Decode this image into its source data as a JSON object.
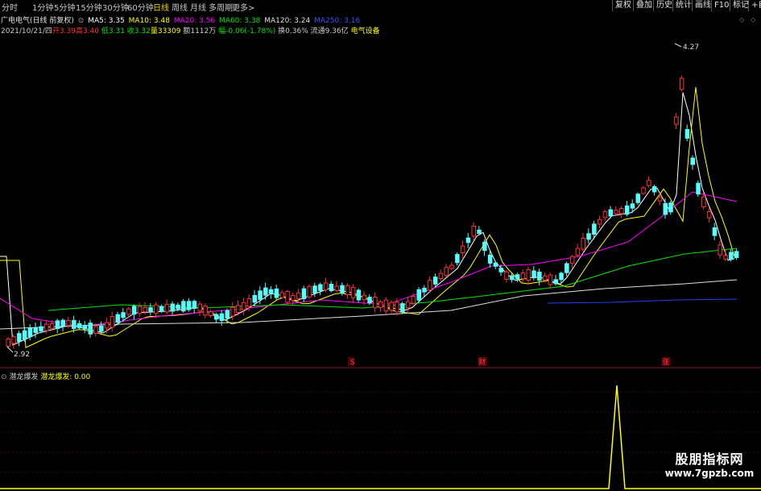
{
  "toolbar": {
    "timeframes": [
      "分时",
      "1分钟",
      "5分钟",
      "15分钟",
      "30分钟",
      "60分钟",
      "日线",
      "周线",
      "月线",
      "多周期",
      "更多>"
    ],
    "active": "日线",
    "right_buttons": [
      "复权",
      "叠加",
      "历史",
      "统计",
      "画线",
      "F10",
      "标记",
      "+自"
    ]
  },
  "info": {
    "stock": "广电电气(日线 前复权)",
    "ma5": "MA5: 3.35",
    "ma10": "MA10: 3.48",
    "ma20": "MA20: 3.56",
    "ma60": "MA60: 3.38",
    "ma120": "MA120: 3.24",
    "ma250": "MA250: 3.16",
    "date": "2021/10/21/四",
    "open": "开3.39",
    "high": "高3.40",
    "low": "低3.31",
    "close": "收3.32",
    "volume": "量33309",
    "amount": "额1112万",
    "change": "幅-0.06(-1.78%)",
    "turnover": "换0.36%",
    "float": "流通9.36亿",
    "sector": "电气设备"
  },
  "chart": {
    "max_label": "4.27",
    "min_label": "2.92",
    "markers": [
      "S",
      "财",
      "涨"
    ]
  },
  "indicator": {
    "name": "潜龙爆发",
    "value": "潜龙爆发: 0.00"
  },
  "watermark": {
    "line1": "股朋指标网",
    "line2": "www.7gpzb.com"
  },
  "colors": {
    "up": "#ff3232",
    "down": "#54ffff",
    "ma5": "#ffffff",
    "ma10": "#ffff00",
    "ma20": "#ff00ff",
    "ma60": "#00e600",
    "ma120": "#e0e0e0",
    "ma250": "#2040ff"
  }
}
